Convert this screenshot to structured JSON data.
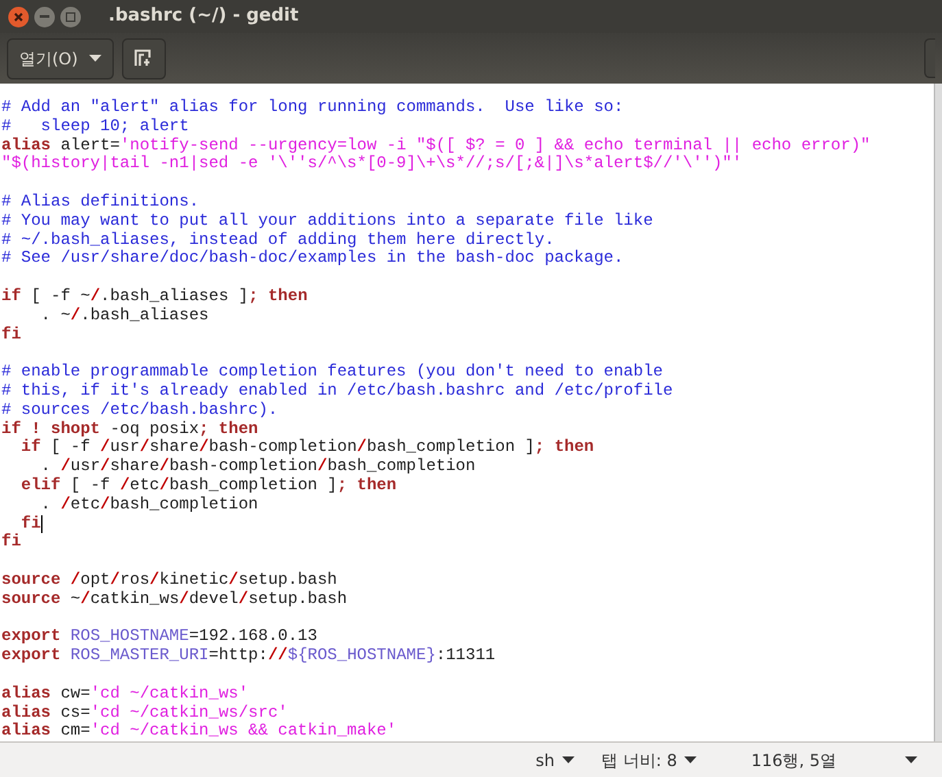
{
  "window": {
    "title": ".bashrc (~/) - gedit"
  },
  "toolbar": {
    "open_button": "열기(O)"
  },
  "editor": {
    "lines": [
      {
        "kind": "code",
        "tokens": [
          {
            "kind": "comment",
            "text": "# Add an \"alert\" alias for long running commands.  Use like so:"
          }
        ]
      },
      {
        "kind": "code",
        "tokens": [
          {
            "kind": "comment",
            "text": "#   sleep 10; alert"
          }
        ]
      },
      {
        "kind": "code",
        "tokens": [
          {
            "kind": "keyword",
            "text": "alias"
          },
          {
            "kind": "plain",
            "text": " alert="
          },
          {
            "kind": "string",
            "text": "'notify-send --urgency=low -i \"$([ $? = 0 ] && echo terminal || echo error)\""
          }
        ]
      },
      {
        "kind": "code",
        "tokens": [
          {
            "kind": "string",
            "text": "\"$(history|tail -n1|sed -e '\\''s/^\\s*[0-9]\\+\\s*//;s/[;&|]\\s*alert$//'\\'')\"'"
          }
        ]
      },
      {
        "kind": "blank"
      },
      {
        "kind": "code",
        "tokens": [
          {
            "kind": "comment",
            "text": "# Alias definitions."
          }
        ]
      },
      {
        "kind": "code",
        "tokens": [
          {
            "kind": "comment",
            "text": "# You may want to put all your additions into a separate file like"
          }
        ]
      },
      {
        "kind": "code",
        "tokens": [
          {
            "kind": "comment",
            "text": "# ~/.bash_aliases, instead of adding them here directly."
          }
        ]
      },
      {
        "kind": "code",
        "tokens": [
          {
            "kind": "comment",
            "text": "# See /usr/share/doc/bash-doc/examples in the bash-doc package."
          }
        ]
      },
      {
        "kind": "blank"
      },
      {
        "kind": "code",
        "tokens": [
          {
            "kind": "keyword",
            "text": "if"
          },
          {
            "kind": "plain",
            "text": " [ -f ~"
          },
          {
            "kind": "slash",
            "text": "/"
          },
          {
            "kind": "plain",
            "text": ".bash_aliases ]"
          },
          {
            "kind": "keyword",
            "text": "; then"
          }
        ]
      },
      {
        "kind": "code",
        "tokens": [
          {
            "kind": "plain",
            "text": "    . ~"
          },
          {
            "kind": "slash",
            "text": "/"
          },
          {
            "kind": "plain",
            "text": ".bash_aliases"
          }
        ]
      },
      {
        "kind": "code",
        "tokens": [
          {
            "kind": "keyword",
            "text": "fi"
          }
        ]
      },
      {
        "kind": "blank"
      },
      {
        "kind": "code",
        "tokens": [
          {
            "kind": "comment",
            "text": "# enable programmable completion features (you don't need to enable"
          }
        ]
      },
      {
        "kind": "code",
        "tokens": [
          {
            "kind": "comment",
            "text": "# this, if it's already enabled in /etc/bash.bashrc and /etc/profile"
          }
        ]
      },
      {
        "kind": "code",
        "tokens": [
          {
            "kind": "comment",
            "text": "# sources /etc/bash.bashrc)."
          }
        ]
      },
      {
        "kind": "code",
        "tokens": [
          {
            "kind": "keyword",
            "text": "if ! shopt"
          },
          {
            "kind": "plain",
            "text": " -oq posix"
          },
          {
            "kind": "keyword",
            "text": "; then"
          }
        ]
      },
      {
        "kind": "code",
        "tokens": [
          {
            "kind": "keyword",
            "text": "  if"
          },
          {
            "kind": "plain",
            "text": " [ -f "
          },
          {
            "kind": "slash",
            "text": "/"
          },
          {
            "kind": "plain",
            "text": "usr"
          },
          {
            "kind": "slash",
            "text": "/"
          },
          {
            "kind": "plain",
            "text": "share"
          },
          {
            "kind": "slash",
            "text": "/"
          },
          {
            "kind": "plain",
            "text": "bash-completion"
          },
          {
            "kind": "slash",
            "text": "/"
          },
          {
            "kind": "plain",
            "text": "bash_completion ]"
          },
          {
            "kind": "keyword",
            "text": "; then"
          }
        ]
      },
      {
        "kind": "code",
        "tokens": [
          {
            "kind": "plain",
            "text": "    . "
          },
          {
            "kind": "slash",
            "text": "/"
          },
          {
            "kind": "plain",
            "text": "usr"
          },
          {
            "kind": "slash",
            "text": "/"
          },
          {
            "kind": "plain",
            "text": "share"
          },
          {
            "kind": "slash",
            "text": "/"
          },
          {
            "kind": "plain",
            "text": "bash-completion"
          },
          {
            "kind": "slash",
            "text": "/"
          },
          {
            "kind": "plain",
            "text": "bash_completion"
          }
        ]
      },
      {
        "kind": "code",
        "tokens": [
          {
            "kind": "keyword",
            "text": "  elif"
          },
          {
            "kind": "plain",
            "text": " [ -f "
          },
          {
            "kind": "slash",
            "text": "/"
          },
          {
            "kind": "plain",
            "text": "etc"
          },
          {
            "kind": "slash",
            "text": "/"
          },
          {
            "kind": "plain",
            "text": "bash_completion ]"
          },
          {
            "kind": "keyword",
            "text": "; then"
          }
        ]
      },
      {
        "kind": "code",
        "tokens": [
          {
            "kind": "plain",
            "text": "    . "
          },
          {
            "kind": "slash",
            "text": "/"
          },
          {
            "kind": "plain",
            "text": "etc"
          },
          {
            "kind": "slash",
            "text": "/"
          },
          {
            "kind": "plain",
            "text": "bash_completion"
          }
        ]
      },
      {
        "kind": "code",
        "cursor": true,
        "tokens": [
          {
            "kind": "keyword",
            "text": "  fi"
          }
        ]
      },
      {
        "kind": "code",
        "tokens": [
          {
            "kind": "keyword",
            "text": "fi"
          }
        ]
      },
      {
        "kind": "blank"
      },
      {
        "kind": "code",
        "tokens": [
          {
            "kind": "keyword",
            "text": "source "
          },
          {
            "kind": "slash",
            "text": "/"
          },
          {
            "kind": "plain",
            "text": "opt"
          },
          {
            "kind": "slash",
            "text": "/"
          },
          {
            "kind": "plain",
            "text": "ros"
          },
          {
            "kind": "slash",
            "text": "/"
          },
          {
            "kind": "plain",
            "text": "kinetic"
          },
          {
            "kind": "slash",
            "text": "/"
          },
          {
            "kind": "plain",
            "text": "setup.bash"
          }
        ]
      },
      {
        "kind": "code",
        "tokens": [
          {
            "kind": "keyword",
            "text": "source"
          },
          {
            "kind": "plain",
            "text": " ~"
          },
          {
            "kind": "slash",
            "text": "/"
          },
          {
            "kind": "plain",
            "text": "catkin_ws"
          },
          {
            "kind": "slash",
            "text": "/"
          },
          {
            "kind": "plain",
            "text": "devel"
          },
          {
            "kind": "slash",
            "text": "/"
          },
          {
            "kind": "plain",
            "text": "setup.bash"
          }
        ]
      },
      {
        "kind": "blank"
      },
      {
        "kind": "code",
        "tokens": [
          {
            "kind": "keyword",
            "text": "export "
          },
          {
            "kind": "variable",
            "text": "ROS_HOSTNAME"
          },
          {
            "kind": "plain",
            "text": "=192.168.0.13"
          }
        ]
      },
      {
        "kind": "code",
        "tokens": [
          {
            "kind": "keyword",
            "text": "export "
          },
          {
            "kind": "variable",
            "text": "ROS_MASTER_URI"
          },
          {
            "kind": "plain",
            "text": "=http:"
          },
          {
            "kind": "slash",
            "text": "//"
          },
          {
            "kind": "variable",
            "text": "${ROS_HOSTNAME}"
          },
          {
            "kind": "plain",
            "text": ":11311"
          }
        ]
      },
      {
        "kind": "blank"
      },
      {
        "kind": "code",
        "tokens": [
          {
            "kind": "keyword",
            "text": "alias"
          },
          {
            "kind": "plain",
            "text": " cw="
          },
          {
            "kind": "string",
            "text": "'cd ~/catkin_ws'"
          }
        ]
      },
      {
        "kind": "code",
        "tokens": [
          {
            "kind": "keyword",
            "text": "alias"
          },
          {
            "kind": "plain",
            "text": " cs="
          },
          {
            "kind": "string",
            "text": "'cd ~/catkin_ws/src'"
          }
        ]
      },
      {
        "kind": "code",
        "tokens": [
          {
            "kind": "keyword",
            "text": "alias"
          },
          {
            "kind": "plain",
            "text": " cm="
          },
          {
            "kind": "string",
            "text": "'cd ~/catkin_ws && catkin_make'"
          }
        ]
      }
    ]
  },
  "status_bar": {
    "language": "sh",
    "tab_width": "탭 너비: 8",
    "position": "116행, 5열"
  }
}
